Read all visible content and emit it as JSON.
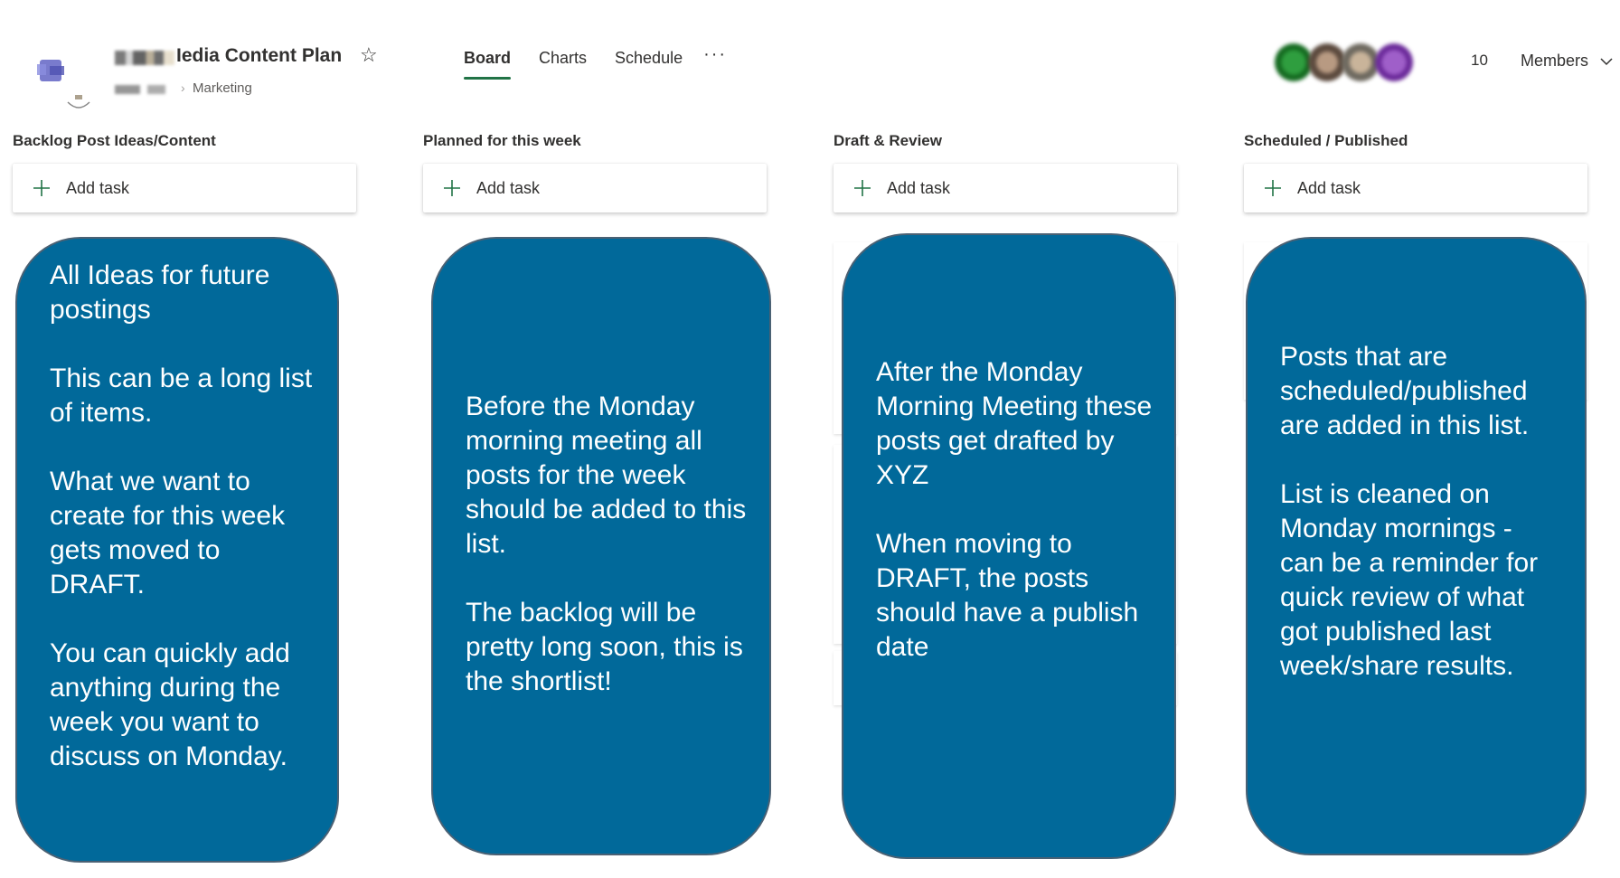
{
  "header": {
    "plan_title": "Iedia Content Plan",
    "group_name": "Marketing",
    "members_count": "10",
    "members_label": "Members",
    "icons": {
      "plan": "planner-plan-icon",
      "favorite": "star-outline-icon",
      "members_dropdown": "chevron-down-icon"
    }
  },
  "nav": {
    "tabs": [
      {
        "label": "Board",
        "active": true
      },
      {
        "label": "Charts",
        "active": false
      },
      {
        "label": "Schedule",
        "active": false
      }
    ],
    "more_label": "···"
  },
  "buckets": [
    {
      "name": "Backlog Post Ideas/Content",
      "add_task_label": "Add task"
    },
    {
      "name": "Planned for this week",
      "add_task_label": "Add task"
    },
    {
      "name": "Draft & Review",
      "add_task_label": "Add task"
    },
    {
      "name": "Scheduled / Published",
      "add_task_label": "Add task"
    }
  ],
  "notes": [
    {
      "paragraphs": [
        "All Ideas for future postings",
        "This can be a long list of items.",
        "What we want to create for this week gets moved to DRAFT.",
        "You can quickly add anything during the week you want to discuss on Monday."
      ]
    },
    {
      "paragraphs": [
        "Before the Monday morning meeting all posts for the week should be added to this list.",
        "The backlog will be pretty long soon, this is the shortlist!"
      ]
    },
    {
      "paragraphs": [
        "After the Monday Morning Meeting these posts get drafted by XYZ",
        "When moving to DRAFT, the posts should have a publish date"
      ]
    },
    {
      "paragraphs": [
        "Posts that are scheduled/published are added in this list.",
        "List is cleaned on Monday mornings - can be a reminder for quick review of what got published last week/share results."
      ]
    }
  ],
  "colors": {
    "note_fill": "#01699a",
    "note_border": "#4a6174",
    "active_tab_underline": "#217346",
    "add_icon": "#217346"
  }
}
